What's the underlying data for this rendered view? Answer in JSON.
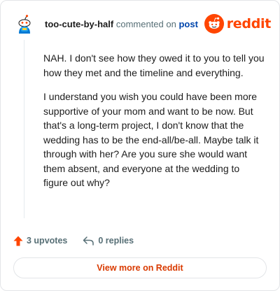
{
  "header": {
    "username": "too-cute-by-half",
    "action_text": "commented on",
    "post_link_label": "post",
    "avatar_icon": "snoo-avatar-icon",
    "brand_logo_icon": "reddit-snoo-logo",
    "brand_name": "reddit"
  },
  "comment": {
    "paragraphs": [
      "NAH. I don't see how they owed it to you to tell you how they met and the timeline and everything.",
      "I understand you wish you could have been more supportive of your mom and want to be now. But that's a long-term project, I don't know that the wedding has to be the end-all/be-all. Maybe talk it through with her? Are you sure she would want them absent, and everyone at the wedding to figure out why?"
    ]
  },
  "footer": {
    "upvotes_label": "3 upvotes",
    "replies_label": "0 replies",
    "upvote_icon": "upvote-arrow-icon",
    "reply_icon": "reply-arrow-icon"
  },
  "view_more_label": "View more on Reddit",
  "colors": {
    "brand": "#ff4500",
    "link": "#0045ac",
    "muted": "#576f76",
    "cta": "#d93a00",
    "border": "#e3e5e8"
  }
}
